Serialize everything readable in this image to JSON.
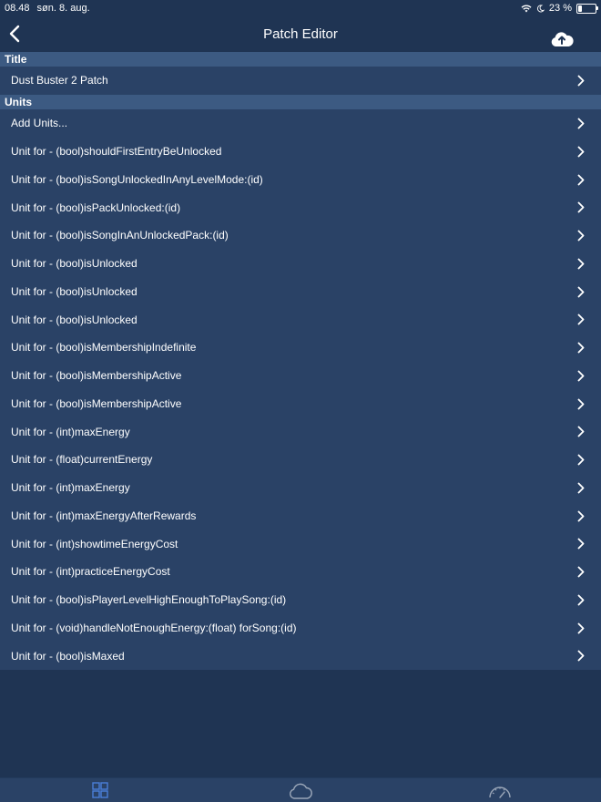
{
  "status": {
    "time": "08.48",
    "date": "søn. 8. aug.",
    "battery": "23 %",
    "battery_level": 0.23
  },
  "nav": {
    "title": "Patch Editor"
  },
  "sections": {
    "title": "Title",
    "units": "Units"
  },
  "title_value": "Dust Buster 2 Patch",
  "units": [
    "Add Units...",
    "Unit for - (bool)shouldFirstEntryBeUnlocked",
    "Unit for - (bool)isSongUnlockedInAnyLevelMode:(id)",
    "Unit for - (bool)isPackUnlocked:(id)",
    "Unit for - (bool)isSongInAnUnlockedPack:(id)",
    "Unit for - (bool)isUnlocked",
    "Unit for - (bool)isUnlocked",
    "Unit for - (bool)isUnlocked",
    "Unit for - (bool)isMembershipIndefinite",
    "Unit for - (bool)isMembershipActive",
    "Unit for - (bool)isMembershipActive",
    "Unit for - (int)maxEnergy",
    "Unit for - (float)currentEnergy",
    "Unit for - (int)maxEnergy",
    "Unit for - (int)maxEnergyAfterRewards",
    "Unit for - (int)showtimeEnergyCost",
    "Unit for - (int)practiceEnergyCost",
    "Unit for - (bool)isPlayerLevelHighEnoughToPlaySong:(id)",
    "Unit for - (void)handleNotEnoughEnergy:(float) forSong:(id)",
    "Unit for - (bool)isMaxed"
  ],
  "tabs": [
    {
      "icon": "grid-icon",
      "active": true
    },
    {
      "icon": "cloud-icon",
      "active": false
    },
    {
      "icon": "speedometer-icon",
      "active": false
    }
  ],
  "colors": {
    "background": "#1f3453",
    "row": "#2a4266",
    "section": "#3c5a82",
    "tab_active": "#4a7fd8",
    "tab_inactive": "#9aa6b8"
  }
}
